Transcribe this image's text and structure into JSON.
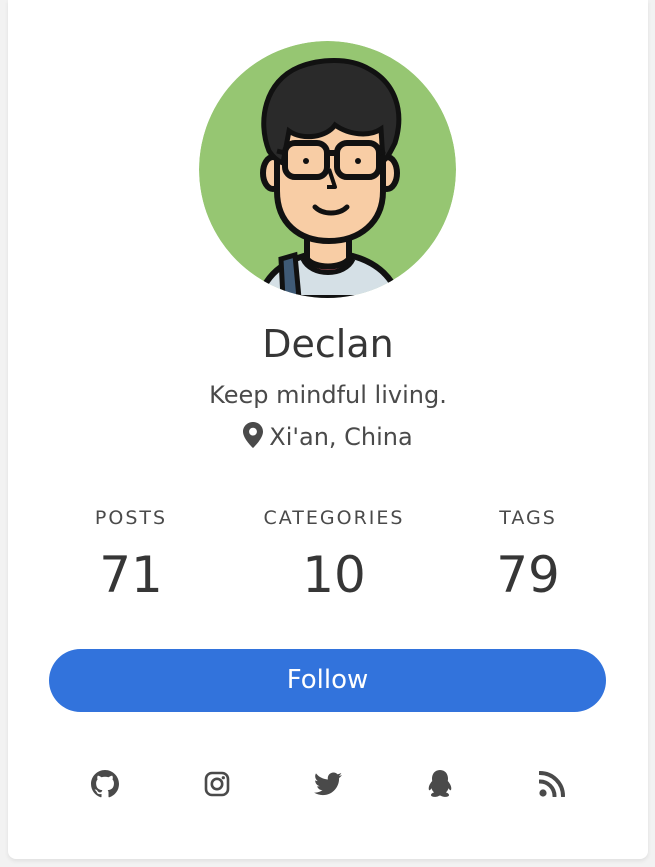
{
  "profile": {
    "avatar_icon": "cartoon-avatar-with-glasses",
    "name": "Declan",
    "bio": "Keep mindful living.",
    "location": "Xi'an, China",
    "location_icon": "map-marker-icon"
  },
  "stats": [
    {
      "label": "POSTS",
      "value": "71"
    },
    {
      "label": "CATEGORIES",
      "value": "10"
    },
    {
      "label": "TAGS",
      "value": "79"
    }
  ],
  "follow_button": {
    "label": "Follow",
    "color": "#3273dc"
  },
  "socials": [
    {
      "name": "github-icon"
    },
    {
      "name": "instagram-icon"
    },
    {
      "name": "twitter-icon"
    },
    {
      "name": "qq-icon"
    },
    {
      "name": "rss-icon"
    }
  ],
  "colors": {
    "avatar_bg": "#96c672",
    "text_primary": "#363636",
    "text_secondary": "#4a4a4a",
    "accent": "#3273dc"
  }
}
